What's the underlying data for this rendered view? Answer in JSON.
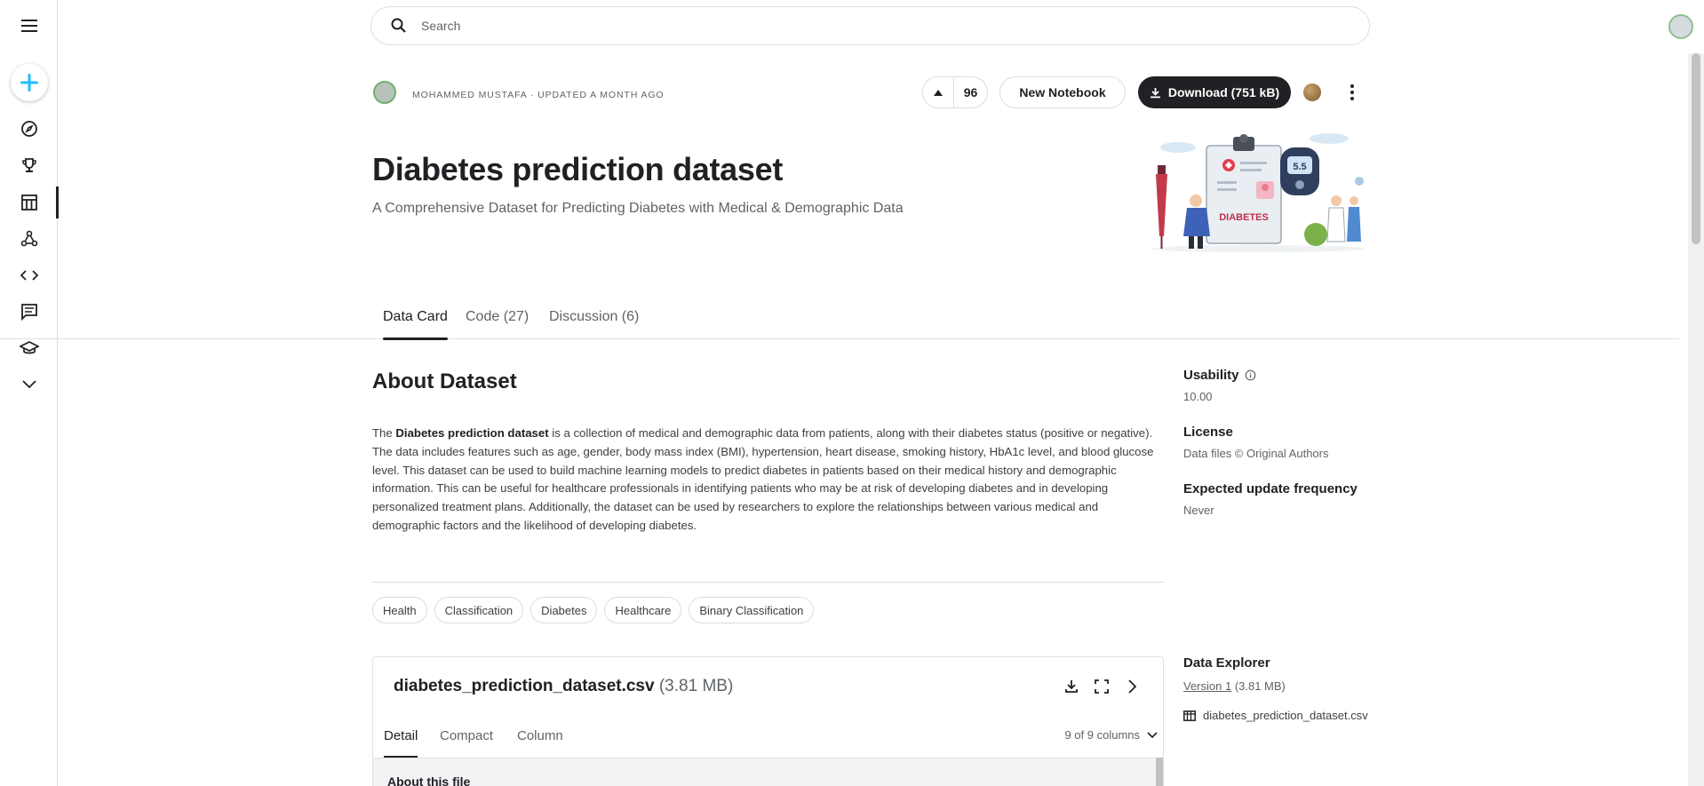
{
  "nav": {
    "items": [
      {
        "icon": "menu-icon"
      },
      {
        "icon": "plus-icon"
      },
      {
        "icon": "compass-icon"
      },
      {
        "icon": "trophy-icon"
      },
      {
        "icon": "table-icon"
      },
      {
        "icon": "models-icon"
      },
      {
        "icon": "code-icon"
      },
      {
        "icon": "discussion-icon"
      },
      {
        "icon": "learn-icon"
      },
      {
        "icon": "chevron-down-icon"
      }
    ],
    "accent": "#20beff"
  },
  "search": {
    "placeholder": "Search"
  },
  "header": {
    "author_line": "MOHAMMED MUSTAFA · UPDATED A MONTH AGO",
    "vote_count": "96",
    "new_notebook_label": "New Notebook",
    "download_label": "Download (751 kB)",
    "title": "Diabetes prediction dataset",
    "subtitle": "A Comprehensive Dataset for Predicting Diabetes with Medical & Demographic Data",
    "banner_text": "DIABETES",
    "banner_reading": "5.5"
  },
  "tabs": [
    {
      "label": "Data Card",
      "active": true
    },
    {
      "label": "Code (27)",
      "active": false
    },
    {
      "label": "Discussion (6)",
      "active": false
    }
  ],
  "about": {
    "heading": "About Dataset",
    "intro": "The ",
    "bold": "Diabetes prediction dataset",
    "body": " is a collection of medical and demographic data from patients, along with their diabetes status (positive or negative). The data includes features such as age, gender, body mass index (BMI), hypertension, heart disease, smoking history, HbA1c level, and blood glucose level. This dataset can be used to build machine learning models to predict diabetes in patients based on their medical history and demographic information. This can be useful for healthcare professionals in identifying patients who may be at risk of developing diabetes and in developing personalized treatment plans. Additionally, the dataset can be used by researchers to explore the relationships between various medical and demographic factors and the likelihood of developing diabetes."
  },
  "tags": [
    "Health",
    "Classification",
    "Diabetes",
    "Healthcare",
    "Binary Classification"
  ],
  "sidebar": {
    "usability_label": "Usability",
    "usability_value": "10.00",
    "license_label": "License",
    "license_value": "Data files © Original Authors",
    "frequency_label": "Expected update frequency",
    "frequency_value": "Never"
  },
  "file_card": {
    "name": "diabetes_prediction_dataset.csv",
    "size": "(3.81 MB)",
    "tabs": [
      {
        "label": "Detail",
        "active": true
      },
      {
        "label": "Compact",
        "active": false
      },
      {
        "label": "Column",
        "active": false
      }
    ],
    "columns_label": "9 of 9 columns",
    "about_file_label": "About this file"
  },
  "explorer": {
    "heading": "Data Explorer",
    "version_link": "Version 1",
    "version_size": " (3.81 MB)",
    "file_name": "diabetes_prediction_dataset.csv"
  }
}
